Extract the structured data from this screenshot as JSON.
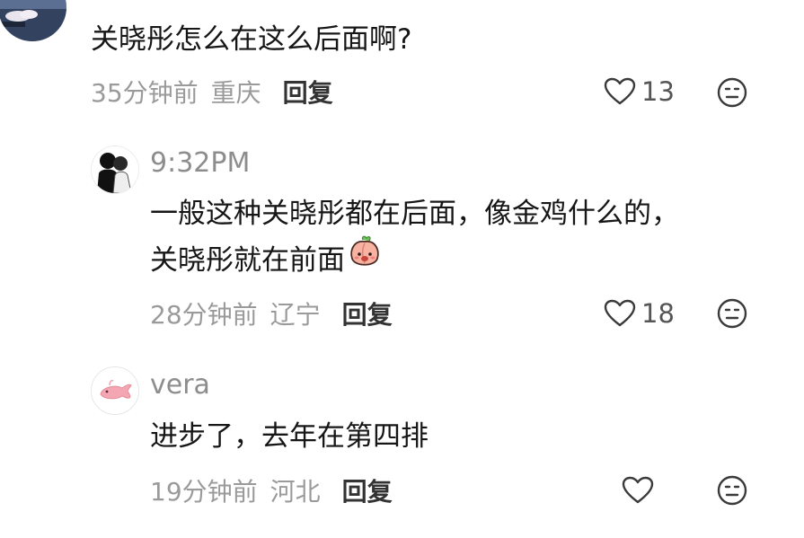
{
  "comments": [
    {
      "text_lines": [
        "关晓彤怎么在这么后面啊?"
      ],
      "time": "35分钟前",
      "location": "重庆",
      "reply_label": "回复",
      "like_count": "13"
    },
    {
      "username": "9:32PM",
      "text_lines": [
        "一般这种关晓彤都在后面，像金鸡什么的，",
        "关晓彤就在前面"
      ],
      "inline_emoji": "peach-emoji",
      "time": "28分钟前",
      "location": "辽宁",
      "reply_label": "回复",
      "like_count": "18"
    },
    {
      "username": "vera",
      "text_lines": [
        "进步了，去年在第四排"
      ],
      "time": "19分钟前",
      "location": "河北",
      "reply_label": "回复",
      "like_count": ""
    }
  ],
  "icons": {
    "like": "heart-outline-icon",
    "dislike": "meh-face-icon"
  }
}
